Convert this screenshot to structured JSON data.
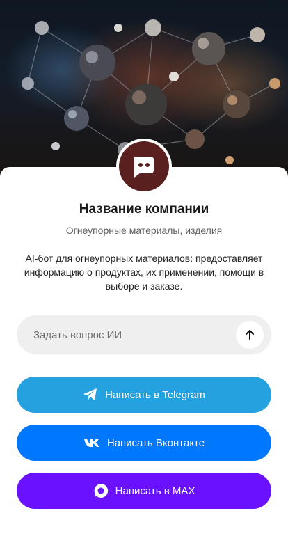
{
  "hero": {
    "image_description_icon": "molecular-lattice-image"
  },
  "profile": {
    "avatar_icon": "chat-bot-icon",
    "company_name": "Название компании",
    "subtitle": "Огнеупорные материалы, изделия",
    "description": "AI-бот для огнеупорных материалов: предоставляет информацию о продуктах, их применении, помощи в выборе и заказе."
  },
  "ask": {
    "placeholder": "Задать вопрос ИИ",
    "value": "",
    "send_icon": "arrow-up-icon"
  },
  "buttons": {
    "telegram": {
      "label": "Написать в Telegram",
      "icon": "telegram-icon",
      "color": "#26a1df"
    },
    "vk": {
      "label": "Написать Вконтакте",
      "icon": "vk-icon",
      "color": "#0077ff"
    },
    "max": {
      "label": "Написать в MAX",
      "icon": "max-icon",
      "color": "#6a11ff"
    }
  },
  "colors": {
    "avatar_bg": "#5a1f1f",
    "ask_bg": "#efefef"
  }
}
